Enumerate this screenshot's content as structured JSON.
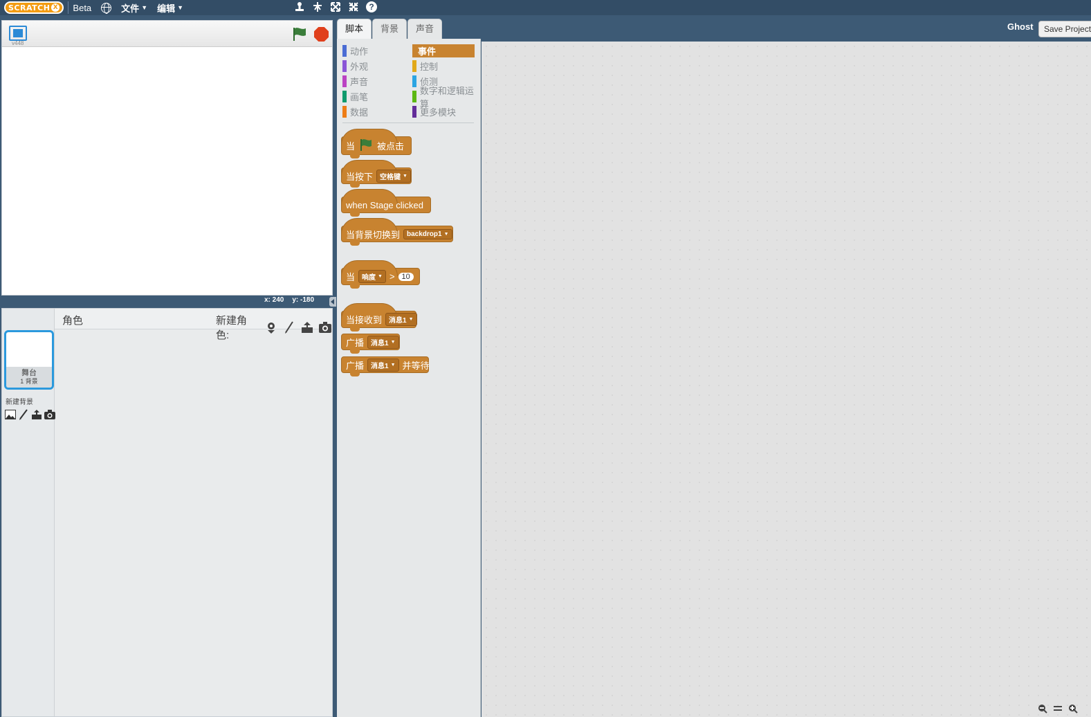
{
  "topbar": {
    "logo_text": "SCRATCH",
    "logo_x": "X",
    "beta_label": "Beta",
    "file_menu": "文件",
    "edit_menu": "编辑",
    "tools": [
      "duplicate-icon",
      "cut-icon",
      "grow-icon",
      "shrink-icon"
    ],
    "help_label": "?"
  },
  "stage": {
    "version": "v448",
    "coord_x": "x: 240",
    "coord_y": "y: -180"
  },
  "sprites": {
    "title": "角色",
    "new_sprite_label": "新建角色:",
    "stage_thumb_label": "舞台",
    "stage_thumb_sub": "1 背景",
    "new_backdrop_label": "新建背景"
  },
  "tabs": [
    "脚本",
    "背景",
    "声音"
  ],
  "user_label": "Ghost",
  "save_button": "Save Project",
  "categories": {
    "left": [
      {
        "label": "动作",
        "color": "#4a6cd4"
      },
      {
        "label": "外观",
        "color": "#8a55d7"
      },
      {
        "label": "声音",
        "color": "#bb42c3"
      },
      {
        "label": "画笔",
        "color": "#0e9a6c"
      },
      {
        "label": "数据",
        "color": "#ee7d16"
      }
    ],
    "right": [
      {
        "label": "事件",
        "color": "#c88330",
        "selected": true
      },
      {
        "label": "控制",
        "color": "#e1a91a"
      },
      {
        "label": "侦测",
        "color": "#2ca5e2"
      },
      {
        "label": "数字和逻辑运算",
        "color": "#5cb712"
      },
      {
        "label": "更多模块",
        "color": "#632d99"
      }
    ]
  },
  "blocks": {
    "flag_prefix": "当",
    "flag_suffix": "被点击",
    "key_prefix": "当按下",
    "key_value": "空格键",
    "stage_clicked": "when Stage clicked",
    "backdrop_prefix": "当背景切换到",
    "backdrop_value": "backdrop1",
    "loudness_prefix": "当",
    "loudness_value": "响度",
    "loudness_op": ">",
    "loudness_num": "10",
    "receive_prefix": "当接收到",
    "receive_value": "消息1",
    "broadcast_prefix": "广播",
    "broadcast_value": "消息1",
    "broadcast_wait_prefix": "广播",
    "broadcast_wait_value": "消息1",
    "broadcast_wait_suffix": "并等待"
  },
  "colors": {
    "events": "#c88330",
    "topbar": "#334d66",
    "accent": "#2b99dd"
  }
}
